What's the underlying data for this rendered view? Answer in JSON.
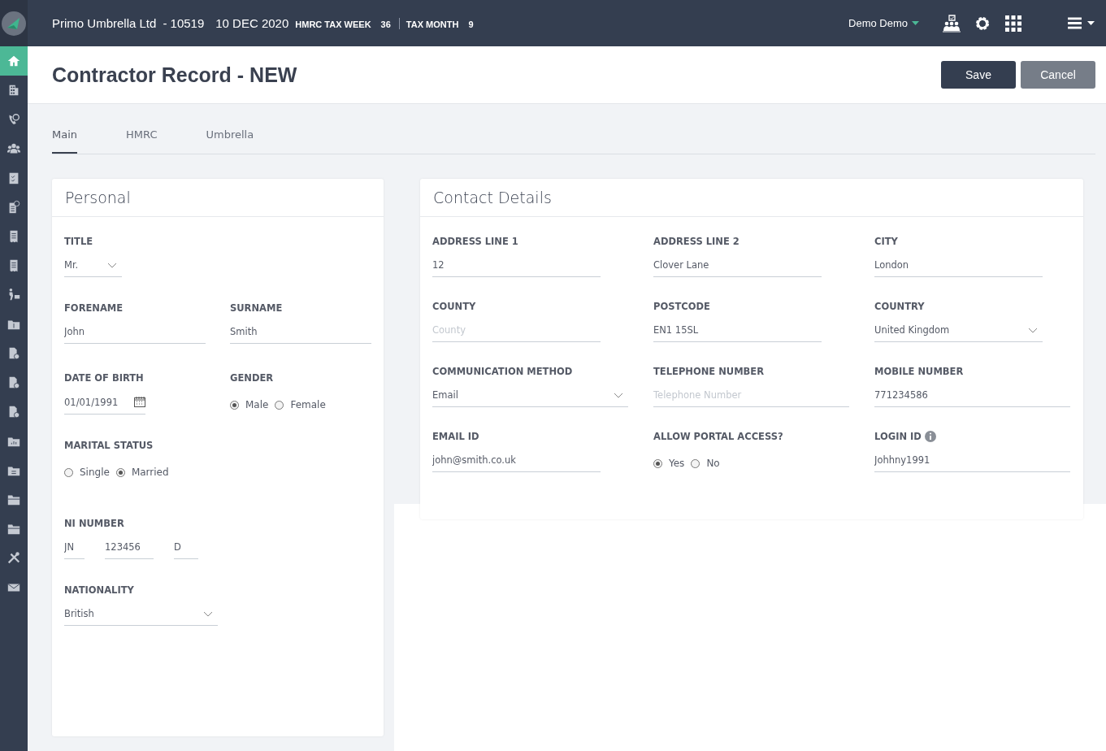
{
  "topbar": {
    "company": "Primo Umbrella Ltd",
    "code": "- 10519",
    "date": "10 DEC 2020",
    "tax_week_label": "HMRC TAX WEEK",
    "tax_week": "36",
    "tax_month_label": "TAX MONTH",
    "tax_month": "9",
    "user": "Demo Demo"
  },
  "sidebar": {
    "items": [
      {
        "selected": true
      },
      {
        "selected": false
      },
      {
        "selected": false
      },
      {
        "selected": false
      },
      {
        "selected": false
      },
      {
        "selected": false
      },
      {
        "selected": false
      },
      {
        "selected": false
      },
      {
        "selected": false
      },
      {
        "selected": false
      },
      {
        "selected": false
      },
      {
        "selected": false
      },
      {
        "selected": false
      },
      {
        "selected": false
      },
      {
        "selected": false
      },
      {
        "selected": false
      },
      {
        "selected": false
      },
      {
        "selected": false
      },
      {
        "selected": false
      }
    ]
  },
  "page": {
    "title": "Contractor Record - NEW",
    "buttons": [
      {
        "label": "Save",
        "kind": "primary"
      },
      {
        "label": "Cancel",
        "kind": "secondary"
      }
    ]
  },
  "tabs": [
    {
      "label": "Main",
      "selected": true
    },
    {
      "label": "HMRC",
      "selected": false
    },
    {
      "label": "Umbrella",
      "selected": false
    }
  ],
  "personal": {
    "title": "Personal",
    "rows": [
      [
        {
          "label": "TITLE",
          "kind": "select",
          "value": "Mr."
        }
      ],
      [
        {
          "label": "FORENAME",
          "kind": "text",
          "value": "John"
        },
        {
          "label": "SURNAME",
          "kind": "text",
          "value": "Smith"
        }
      ],
      [
        {
          "label": "DATE OF BIRTH",
          "kind": "date",
          "value": "01/01/1991"
        },
        {
          "label": "GENDER",
          "kind": "radio",
          "options": [
            {
              "label": "Male",
              "selected": true
            },
            {
              "label": "Female",
              "selected": false
            }
          ]
        }
      ],
      [
        {
          "label": "MARITAL STATUS",
          "kind": "radio",
          "options": [
            {
              "label": "Single",
              "selected": false
            },
            {
              "label": "Married",
              "selected": true
            }
          ]
        }
      ],
      [
        {
          "label": "NI NUMBER",
          "kind": "ni",
          "parts": [
            "JN",
            "123456",
            "D"
          ]
        }
      ],
      [
        {
          "label": "NATIONALITY",
          "kind": "select",
          "value": "British"
        }
      ]
    ]
  },
  "contact": {
    "title": "Contact Details",
    "rows": [
      [
        {
          "label": "ADDRESS LINE 1",
          "kind": "text",
          "value": "12"
        },
        {
          "label": "ADDRESS LINE 2",
          "kind": "text",
          "value": "Clover Lane"
        },
        {
          "label": "CITY",
          "kind": "text",
          "value": "London"
        }
      ],
      [
        {
          "label": "COUNTY",
          "kind": "text",
          "placeholder": "County"
        },
        {
          "label": "POSTCODE",
          "kind": "text",
          "value": "EN1 15SL"
        },
        {
          "label": "COUNTRY",
          "kind": "select",
          "value": "United Kingdom"
        }
      ],
      [
        {
          "label": "COMMUNICATION METHOD",
          "kind": "select",
          "value": "Email"
        },
        {
          "label": "TELEPHONE NUMBER",
          "kind": "text",
          "placeholder": "Telephone Number"
        },
        {
          "label": "MOBILE NUMBER",
          "kind": "text",
          "value": "771234586"
        }
      ],
      [
        {
          "label": "EMAIL ID",
          "kind": "text",
          "value": "john@smith.co.uk"
        },
        {
          "label": "ALLOW PORTAL ACCESS?",
          "kind": "radio",
          "options": [
            {
              "label": "Yes",
              "selected": true
            },
            {
              "label": "No",
              "selected": false
            }
          ]
        },
        {
          "label": "LOGIN ID",
          "kind": "text",
          "value": "Johhny1991",
          "info": true
        }
      ]
    ]
  }
}
